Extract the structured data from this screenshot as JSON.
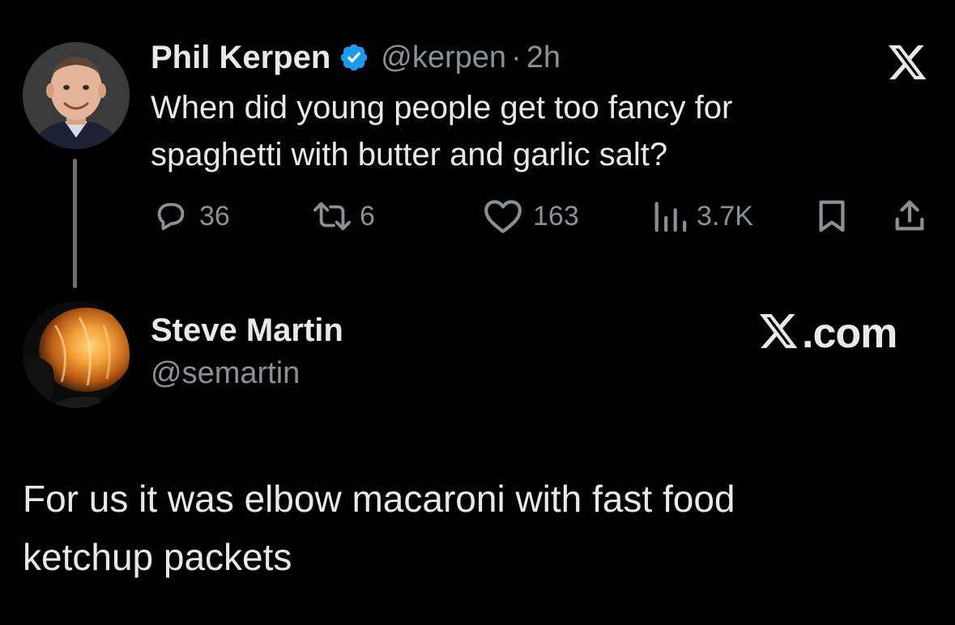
{
  "tweet": {
    "author": {
      "display_name": "Phil Kerpen",
      "handle": "@kerpen",
      "separator": "·",
      "time": "2h",
      "verified": true
    },
    "text_line1": "When did young people get too fancy for",
    "text_line2": "spaghetti with butter and garlic salt?",
    "stats": {
      "replies": "36",
      "reposts": "6",
      "likes": "163",
      "views": "3.7K"
    }
  },
  "reply": {
    "author": {
      "display_name": "Steve Martin",
      "handle": "@semartin"
    },
    "watermark": "X.com",
    "text_line1": "For us it was elbow macaroni with fast food",
    "text_line2": "ketchup packets"
  },
  "icons": {
    "verified": "verified-badge-icon",
    "reply": "reply-bubble-icon",
    "repost": "repost-icon",
    "like": "heart-icon",
    "views": "views-bar-icon",
    "bookmark": "bookmark-icon",
    "share": "share-icon",
    "brand": "x-logo-icon"
  },
  "colors": {
    "background": "#000000",
    "text_primary": "#e7e9ea",
    "text_secondary": "#8b9096",
    "verified_blue": "#1d9bf0",
    "thread_line": "#6e7174"
  }
}
